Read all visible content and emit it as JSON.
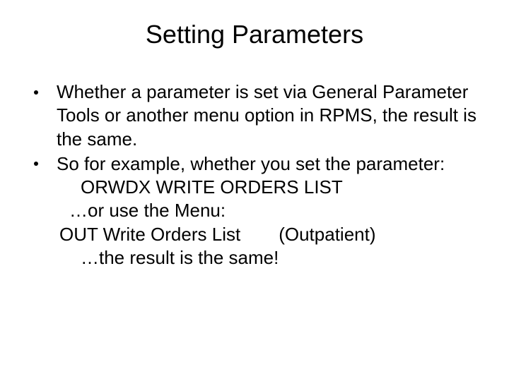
{
  "title": "Setting Parameters",
  "bullets": [
    {
      "text": "Whether a parameter is set via General Parameter Tools or another menu option in RPMS, the result is the same."
    },
    {
      "text": "So for example, whether you set the parameter:",
      "sublines": {
        "param_name": "ORWDX WRITE ORDERS LIST",
        "or_menu": "…or use the Menu:",
        "out_left": "OUT Write Orders List",
        "out_right": "(Outpatient)",
        "result": "…the result is the same!"
      }
    }
  ]
}
